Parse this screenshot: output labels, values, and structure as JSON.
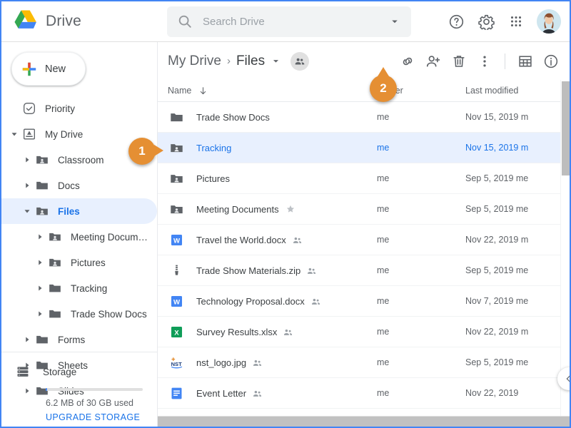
{
  "window": {
    "title": "Google Drive"
  },
  "header": {
    "brand": "Drive",
    "logo_icon": "drive-logo-icon",
    "search": {
      "placeholder": "Search Drive",
      "value": "",
      "icon": "search-icon",
      "options_icon": "chevron-down-icon"
    },
    "actions": [
      {
        "name": "help-button",
        "icon": "question-circle-icon"
      },
      {
        "name": "settings-button",
        "icon": "gear-icon"
      },
      {
        "name": "apps-button",
        "icon": "grid-apps-icon"
      }
    ],
    "avatar": {
      "name": "user-avatar",
      "alt": "account"
    }
  },
  "sidebar": {
    "new_button": {
      "label": "New",
      "icon": "plus-icon"
    },
    "items": [
      {
        "label": "Priority",
        "icon": "check-circle-icon",
        "indent": 0,
        "twisty": "none",
        "selected": false,
        "shared": false
      },
      {
        "label": "My Drive",
        "icon": "my-drive-icon",
        "indent": 0,
        "twisty": "expanded",
        "selected": false,
        "shared": false
      },
      {
        "label": "Classroom",
        "icon": "folder-icon",
        "indent": 1,
        "twisty": "collapsed",
        "selected": false,
        "shared": true
      },
      {
        "label": "Docs",
        "icon": "folder-icon",
        "indent": 1,
        "twisty": "collapsed",
        "selected": false,
        "shared": false
      },
      {
        "label": "Files",
        "icon": "folder-icon",
        "indent": 1,
        "twisty": "expanded",
        "selected": true,
        "shared": true
      },
      {
        "label": "Meeting Documen…",
        "icon": "folder-icon",
        "indent": 2,
        "twisty": "collapsed",
        "selected": false,
        "shared": true
      },
      {
        "label": "Pictures",
        "icon": "folder-icon",
        "indent": 2,
        "twisty": "collapsed",
        "selected": false,
        "shared": true
      },
      {
        "label": "Tracking",
        "icon": "folder-icon",
        "indent": 2,
        "twisty": "collapsed",
        "selected": false,
        "shared": false
      },
      {
        "label": "Trade Show Docs",
        "icon": "folder-icon",
        "indent": 2,
        "twisty": "collapsed",
        "selected": false,
        "shared": false
      },
      {
        "label": "Forms",
        "icon": "folder-icon",
        "indent": 1,
        "twisty": "collapsed",
        "selected": false,
        "shared": false
      },
      {
        "label": "Sheets",
        "icon": "folder-icon",
        "indent": 1,
        "twisty": "collapsed",
        "selected": false,
        "shared": false
      },
      {
        "label": "Slides",
        "icon": "folder-icon",
        "indent": 1,
        "twisty": "collapsed",
        "selected": false,
        "shared": false
      }
    ],
    "storage": {
      "label": "Storage",
      "icon": "storage-icon",
      "used_text": "6.2 MB of 30 GB used",
      "upgrade_label": "UPGRADE STORAGE",
      "used_percent": 1
    }
  },
  "main": {
    "breadcrumb": {
      "root": "My Drive",
      "separator": "›",
      "current": "Files",
      "caret_icon": "chevron-down-icon",
      "shared_badge_icon": "people-icon"
    },
    "toolbar": [
      {
        "name": "get-link-button",
        "icon": "link-icon"
      },
      {
        "name": "add-people-button",
        "icon": "person-add-icon"
      },
      {
        "name": "remove-button",
        "icon": "trash-icon"
      },
      {
        "name": "more-actions-button",
        "icon": "more-vertical-icon"
      },
      {
        "name": "grid-view-button",
        "icon": "grid-view-icon"
      },
      {
        "name": "details-button",
        "icon": "info-icon"
      }
    ],
    "columns": [
      {
        "key": "name",
        "label": "Name",
        "sort_icon": "arrow-down-icon"
      },
      {
        "key": "owner",
        "label": "Owner"
      },
      {
        "key": "modified",
        "label": "Last modified"
      }
    ],
    "rows": [
      {
        "name": "Trade Show Docs",
        "icon": "folder-icon",
        "shared": false,
        "starred": false,
        "owner": "me",
        "modified": "Nov 15, 2019 m",
        "selected": false
      },
      {
        "name": "Tracking",
        "icon": "folder-icon",
        "shared": true,
        "starred": false,
        "owner": "me",
        "modified": "Nov 15, 2019 m",
        "selected": true
      },
      {
        "name": "Pictures",
        "icon": "folder-icon",
        "shared": true,
        "starred": false,
        "owner": "me",
        "modified": "Sep 5, 2019 me",
        "selected": false
      },
      {
        "name": "Meeting Documents",
        "icon": "folder-icon",
        "shared": true,
        "starred": true,
        "owner": "me",
        "modified": "Sep 5, 2019 me",
        "selected": false
      },
      {
        "name": "Travel the World.docx",
        "icon": "word-icon",
        "shared": true,
        "starred": false,
        "owner": "me",
        "modified": "Nov 22, 2019 m",
        "selected": false
      },
      {
        "name": "Trade Show Materials.zip",
        "icon": "zip-icon",
        "shared": true,
        "starred": false,
        "owner": "me",
        "modified": "Sep 5, 2019 me",
        "selected": false
      },
      {
        "name": "Technology Proposal.docx",
        "icon": "word-icon",
        "shared": true,
        "starred": false,
        "owner": "me",
        "modified": "Nov 7, 2019 me",
        "selected": false
      },
      {
        "name": "Survey Results.xlsx",
        "icon": "excel-icon",
        "shared": true,
        "starred": false,
        "owner": "me",
        "modified": "Nov 22, 2019 m",
        "selected": false
      },
      {
        "name": "nst_logo.jpg",
        "icon": "nst-logo-icon",
        "shared": true,
        "starred": false,
        "owner": "me",
        "modified": "Sep 5, 2019 me",
        "selected": false
      },
      {
        "name": "Event Letter",
        "icon": "gdoc-icon",
        "shared": true,
        "starred": false,
        "owner": "me",
        "modified": "Nov 22, 2019",
        "selected": false
      }
    ],
    "collapse_button": {
      "name": "collapse-panel-button",
      "icon": "chevron-left-icon"
    }
  },
  "callouts": [
    {
      "number": "1",
      "direction": "right"
    },
    {
      "number": "2",
      "direction": "up"
    }
  ],
  "colors": {
    "accent_blue": "#1a73e8",
    "selected_row": "#e8f0fe",
    "callout_orange": "#e58f33",
    "text_primary": "#3c4043",
    "text_secondary": "#5f6368"
  }
}
